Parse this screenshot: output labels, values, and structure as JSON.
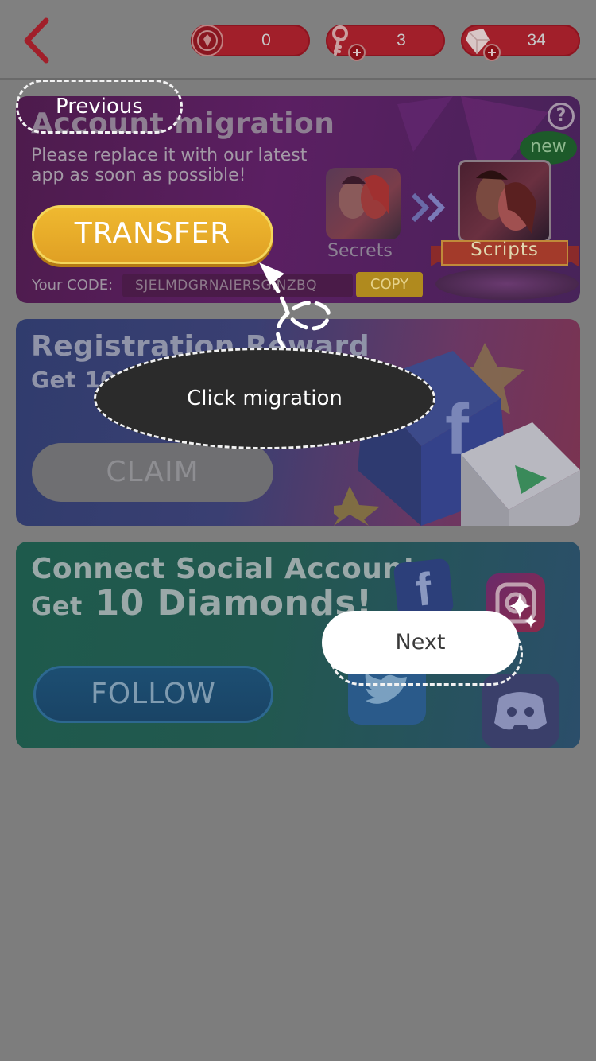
{
  "header": {
    "back_icon": "chevron-left-icon",
    "counters": [
      {
        "icon": "gem-badge-icon",
        "value": "0"
      },
      {
        "icon": "key-icon",
        "value": "3"
      },
      {
        "icon": "diamond-icon",
        "value": "34"
      }
    ],
    "accent": "#a11f2a"
  },
  "migration": {
    "title": "Account migration",
    "description": "Please replace it with our latest app as soon as possible!",
    "transfer_label": "TRANSFER",
    "code_label": "Your CODE:",
    "code_value": "SJELMDGRNAIERSGINZBQ",
    "copy_label": "COPY",
    "help_symbol": "?",
    "new_badge": "new",
    "secrets_label": "Secrets",
    "scripts_label": "Scripts"
  },
  "registration": {
    "title": "Registration Reward",
    "subtitle": "Get 10",
    "claim_label": "CLAIM"
  },
  "social": {
    "title": "Connect Social Account",
    "subtitle_prefix": "Get",
    "subtitle_main": "10 Diamonds!",
    "follow_label": "FOLLOW"
  },
  "tutorial": {
    "previous_label": "Previous",
    "tip_text": "Click migration",
    "next_label": "Next"
  }
}
